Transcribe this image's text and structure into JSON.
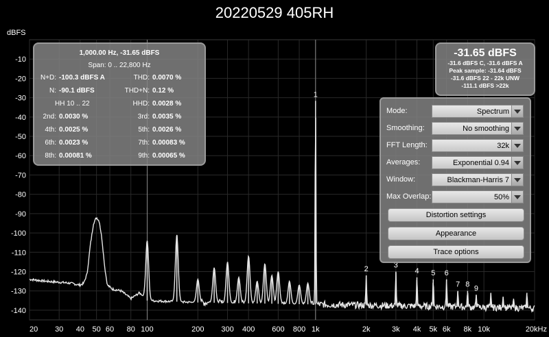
{
  "title": "20220529 405RH",
  "y_unit": "dBFS",
  "stats": {
    "header": "1,000.00 Hz, -31.65 dBFS",
    "span": "Span: 0 .. 22,800 Hz",
    "rows": [
      {
        "l1": "N+D:",
        "v1": "-100.3 dBFS A",
        "l2": "THD:",
        "v2": "0.0070 %"
      },
      {
        "l1": "N:",
        "v1": "-90.1 dBFS",
        "l2": "THD+N:",
        "v2": "0.12 %"
      },
      {
        "l1": "",
        "v1": "HH 10 .. 22",
        "l2": "HHD:",
        "v2": "0.0028 %"
      },
      {
        "l1": "2nd:",
        "v1": "0.0030 %",
        "l2": "3rd:",
        "v2": "0.0035 %"
      },
      {
        "l1": "4th:",
        "v1": "0.0025 %",
        "l2": "5th:",
        "v2": "0.0026 %"
      },
      {
        "l1": "6th:",
        "v1": "0.0023 %",
        "l2": "7th:",
        "v2": "0.00083 %"
      },
      {
        "l1": "8th:",
        "v1": "0.00081 %",
        "l2": "9th:",
        "v2": "0.00065 %"
      }
    ]
  },
  "level": {
    "big": "-31.65 dBFS",
    "lines": [
      "-31.6 dBFS C, -31.6 dBFS A",
      "Peak sample: -31.64 dBFS",
      "-31.6 dBFS 22 - 22k UNW",
      "-111.1 dBFS >22k"
    ]
  },
  "settings": [
    {
      "label": "Mode:",
      "value": "Spectrum"
    },
    {
      "label": "Smoothing:",
      "value": "No  smoothing"
    },
    {
      "label": "FFT Length:",
      "value": "32k"
    },
    {
      "label": "Averages:",
      "value": "Exponential 0.94"
    },
    {
      "label": "Window:",
      "value": "Blackman-Harris 7"
    },
    {
      "label": "Max Overlap:",
      "value": "50%"
    }
  ],
  "buttons": [
    "Distortion settings",
    "Appearance",
    "Trace options"
  ],
  "colors": {
    "trace": "#e6e6e6",
    "grid": "#2a2a2a",
    "axis_text": "#ffffff",
    "bg": "#000000"
  },
  "chart_data": {
    "type": "line",
    "x_scale": "log",
    "xlim": [
      20,
      20000
    ],
    "ylim": [
      -145,
      0
    ],
    "y_ticks": [
      -10,
      -20,
      -30,
      -40,
      -50,
      -60,
      -70,
      -80,
      -90,
      -100,
      -110,
      -120,
      -130,
      -140
    ],
    "y_tick_labels": [
      "-10",
      "-20",
      "-30",
      "-40",
      "-50",
      "-60",
      "-70",
      "-80",
      "-90",
      "-100",
      "-110",
      "-120",
      "-130",
      "-140"
    ],
    "x_ticks": [
      20,
      30,
      40,
      50,
      60,
      80,
      100,
      200,
      300,
      400,
      600,
      800,
      1000,
      2000,
      3000,
      4000,
      5000,
      6000,
      8000,
      10000,
      20000
    ],
    "x_tick_labels": [
      "20",
      "30",
      "40",
      "50",
      "60",
      "80",
      "100",
      "200",
      "300",
      "400",
      "600",
      "800",
      "1k",
      "2k",
      "3k",
      "4k",
      "5k",
      "6k",
      "8k",
      "10k",
      "20kHz"
    ],
    "baseline": [
      [
        20,
        -124
      ],
      [
        25,
        -125
      ],
      [
        30,
        -125.5
      ],
      [
        35,
        -126
      ],
      [
        40,
        -127
      ],
      [
        42,
        -126
      ],
      [
        44,
        -121
      ],
      [
        46,
        -106
      ],
      [
        48,
        -95
      ],
      [
        50,
        -92
      ],
      [
        52,
        -94
      ],
      [
        54,
        -104
      ],
      [
        56,
        -118
      ],
      [
        58,
        -127
      ],
      [
        62,
        -129
      ],
      [
        70,
        -130
      ],
      [
        80,
        -134
      ],
      [
        90,
        -131
      ],
      [
        100,
        -135
      ],
      [
        200,
        -136
      ],
      [
        1000,
        -137
      ],
      [
        5000,
        -138
      ],
      [
        20000,
        -139
      ]
    ],
    "peaks": [
      {
        "f": 100,
        "db": -104
      },
      {
        "f": 150,
        "db": -101
      },
      {
        "f": 200,
        "db": -124
      },
      {
        "f": 250,
        "db": -118
      },
      {
        "f": 300,
        "db": -115
      },
      {
        "f": 350,
        "db": -123
      },
      {
        "f": 400,
        "db": -112
      },
      {
        "f": 450,
        "db": -125
      },
      {
        "f": 500,
        "db": -116
      },
      {
        "f": 550,
        "db": -122
      },
      {
        "f": 600,
        "db": -120
      },
      {
        "f": 700,
        "db": -125
      },
      {
        "f": 800,
        "db": -127
      },
      {
        "f": 900,
        "db": -126
      },
      {
        "f": 1000,
        "db": -31.65,
        "label": "1"
      },
      {
        "f": 2000,
        "db": -122,
        "label": "2"
      },
      {
        "f": 3000,
        "db": -120,
        "label": "3"
      },
      {
        "f": 4000,
        "db": -123,
        "label": "4"
      },
      {
        "f": 5000,
        "db": -124,
        "label": "5"
      },
      {
        "f": 6000,
        "db": -124,
        "label": "6"
      },
      {
        "f": 7000,
        "db": -130,
        "label": "7"
      },
      {
        "f": 8000,
        "db": -130,
        "label": "8"
      },
      {
        "f": 9000,
        "db": -132,
        "label": "9"
      },
      {
        "f": 11000,
        "db": -131
      },
      {
        "f": 13000,
        "db": -133
      },
      {
        "f": 15000,
        "db": -134
      },
      {
        "f": 18000,
        "db": -131
      }
    ]
  }
}
